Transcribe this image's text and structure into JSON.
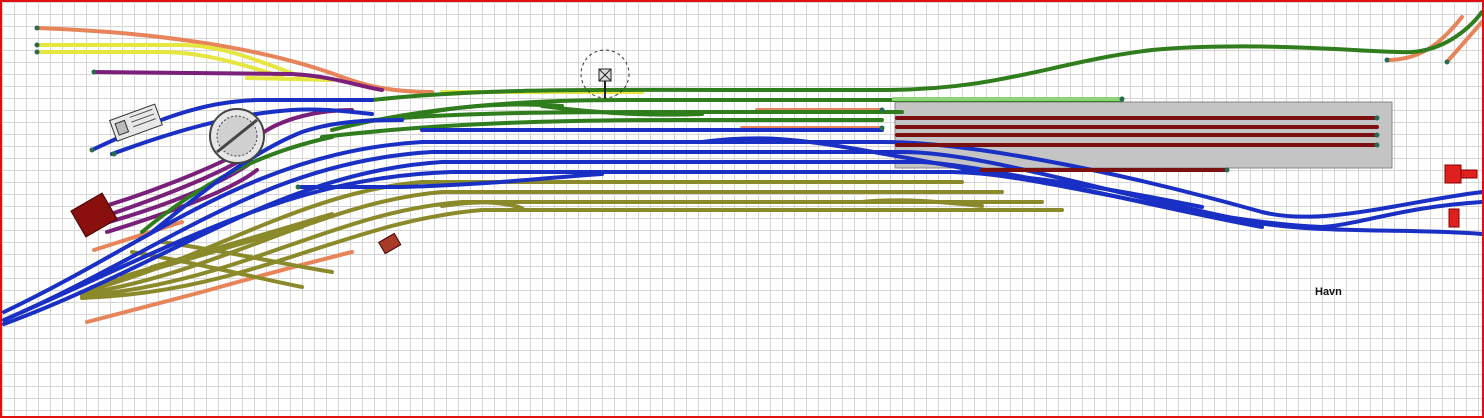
{
  "label": {
    "station": "Havn"
  },
  "colors": {
    "border": "#e01010",
    "grid": "#d6d6d6",
    "main_lines": "#1a2fc4",
    "upper_yard": "#2f7d1c",
    "freight_yard": "#8a8a2a",
    "siding_orange": "#e8845a",
    "siding_yellow": "#e6e640",
    "purple_lines": "#7a1f7a",
    "shed_tracks": "#7a1010",
    "shed_platform": "#c4c4c4",
    "buffer_red": "#e02020"
  },
  "icons": [
    "turntable-icon",
    "signal-box-icon",
    "water-tower-icon",
    "engine-shed-icon",
    "goods-shed-icon",
    "buffer-stop-icon"
  ]
}
